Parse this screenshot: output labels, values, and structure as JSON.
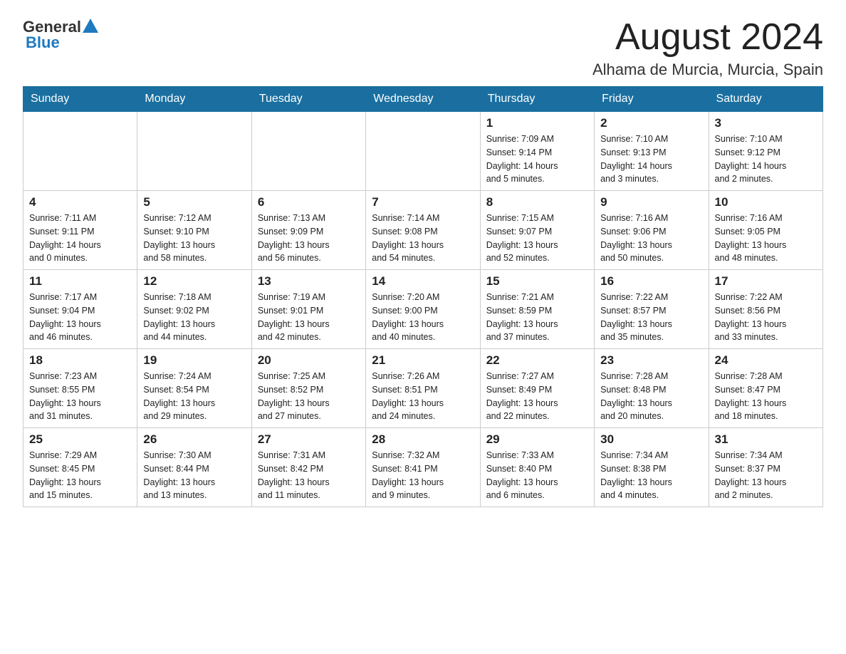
{
  "header": {
    "logo_general": "General",
    "logo_blue": "Blue",
    "month_year": "August 2024",
    "location": "Alhama de Murcia, Murcia, Spain"
  },
  "days_of_week": [
    "Sunday",
    "Monday",
    "Tuesday",
    "Wednesday",
    "Thursday",
    "Friday",
    "Saturday"
  ],
  "weeks": [
    [
      {
        "day": "",
        "info": ""
      },
      {
        "day": "",
        "info": ""
      },
      {
        "day": "",
        "info": ""
      },
      {
        "day": "",
        "info": ""
      },
      {
        "day": "1",
        "info": "Sunrise: 7:09 AM\nSunset: 9:14 PM\nDaylight: 14 hours\nand 5 minutes."
      },
      {
        "day": "2",
        "info": "Sunrise: 7:10 AM\nSunset: 9:13 PM\nDaylight: 14 hours\nand 3 minutes."
      },
      {
        "day": "3",
        "info": "Sunrise: 7:10 AM\nSunset: 9:12 PM\nDaylight: 14 hours\nand 2 minutes."
      }
    ],
    [
      {
        "day": "4",
        "info": "Sunrise: 7:11 AM\nSunset: 9:11 PM\nDaylight: 14 hours\nand 0 minutes."
      },
      {
        "day": "5",
        "info": "Sunrise: 7:12 AM\nSunset: 9:10 PM\nDaylight: 13 hours\nand 58 minutes."
      },
      {
        "day": "6",
        "info": "Sunrise: 7:13 AM\nSunset: 9:09 PM\nDaylight: 13 hours\nand 56 minutes."
      },
      {
        "day": "7",
        "info": "Sunrise: 7:14 AM\nSunset: 9:08 PM\nDaylight: 13 hours\nand 54 minutes."
      },
      {
        "day": "8",
        "info": "Sunrise: 7:15 AM\nSunset: 9:07 PM\nDaylight: 13 hours\nand 52 minutes."
      },
      {
        "day": "9",
        "info": "Sunrise: 7:16 AM\nSunset: 9:06 PM\nDaylight: 13 hours\nand 50 minutes."
      },
      {
        "day": "10",
        "info": "Sunrise: 7:16 AM\nSunset: 9:05 PM\nDaylight: 13 hours\nand 48 minutes."
      }
    ],
    [
      {
        "day": "11",
        "info": "Sunrise: 7:17 AM\nSunset: 9:04 PM\nDaylight: 13 hours\nand 46 minutes."
      },
      {
        "day": "12",
        "info": "Sunrise: 7:18 AM\nSunset: 9:02 PM\nDaylight: 13 hours\nand 44 minutes."
      },
      {
        "day": "13",
        "info": "Sunrise: 7:19 AM\nSunset: 9:01 PM\nDaylight: 13 hours\nand 42 minutes."
      },
      {
        "day": "14",
        "info": "Sunrise: 7:20 AM\nSunset: 9:00 PM\nDaylight: 13 hours\nand 40 minutes."
      },
      {
        "day": "15",
        "info": "Sunrise: 7:21 AM\nSunset: 8:59 PM\nDaylight: 13 hours\nand 37 minutes."
      },
      {
        "day": "16",
        "info": "Sunrise: 7:22 AM\nSunset: 8:57 PM\nDaylight: 13 hours\nand 35 minutes."
      },
      {
        "day": "17",
        "info": "Sunrise: 7:22 AM\nSunset: 8:56 PM\nDaylight: 13 hours\nand 33 minutes."
      }
    ],
    [
      {
        "day": "18",
        "info": "Sunrise: 7:23 AM\nSunset: 8:55 PM\nDaylight: 13 hours\nand 31 minutes."
      },
      {
        "day": "19",
        "info": "Sunrise: 7:24 AM\nSunset: 8:54 PM\nDaylight: 13 hours\nand 29 minutes."
      },
      {
        "day": "20",
        "info": "Sunrise: 7:25 AM\nSunset: 8:52 PM\nDaylight: 13 hours\nand 27 minutes."
      },
      {
        "day": "21",
        "info": "Sunrise: 7:26 AM\nSunset: 8:51 PM\nDaylight: 13 hours\nand 24 minutes."
      },
      {
        "day": "22",
        "info": "Sunrise: 7:27 AM\nSunset: 8:49 PM\nDaylight: 13 hours\nand 22 minutes."
      },
      {
        "day": "23",
        "info": "Sunrise: 7:28 AM\nSunset: 8:48 PM\nDaylight: 13 hours\nand 20 minutes."
      },
      {
        "day": "24",
        "info": "Sunrise: 7:28 AM\nSunset: 8:47 PM\nDaylight: 13 hours\nand 18 minutes."
      }
    ],
    [
      {
        "day": "25",
        "info": "Sunrise: 7:29 AM\nSunset: 8:45 PM\nDaylight: 13 hours\nand 15 minutes."
      },
      {
        "day": "26",
        "info": "Sunrise: 7:30 AM\nSunset: 8:44 PM\nDaylight: 13 hours\nand 13 minutes."
      },
      {
        "day": "27",
        "info": "Sunrise: 7:31 AM\nSunset: 8:42 PM\nDaylight: 13 hours\nand 11 minutes."
      },
      {
        "day": "28",
        "info": "Sunrise: 7:32 AM\nSunset: 8:41 PM\nDaylight: 13 hours\nand 9 minutes."
      },
      {
        "day": "29",
        "info": "Sunrise: 7:33 AM\nSunset: 8:40 PM\nDaylight: 13 hours\nand 6 minutes."
      },
      {
        "day": "30",
        "info": "Sunrise: 7:34 AM\nSunset: 8:38 PM\nDaylight: 13 hours\nand 4 minutes."
      },
      {
        "day": "31",
        "info": "Sunrise: 7:34 AM\nSunset: 8:37 PM\nDaylight: 13 hours\nand 2 minutes."
      }
    ]
  ]
}
